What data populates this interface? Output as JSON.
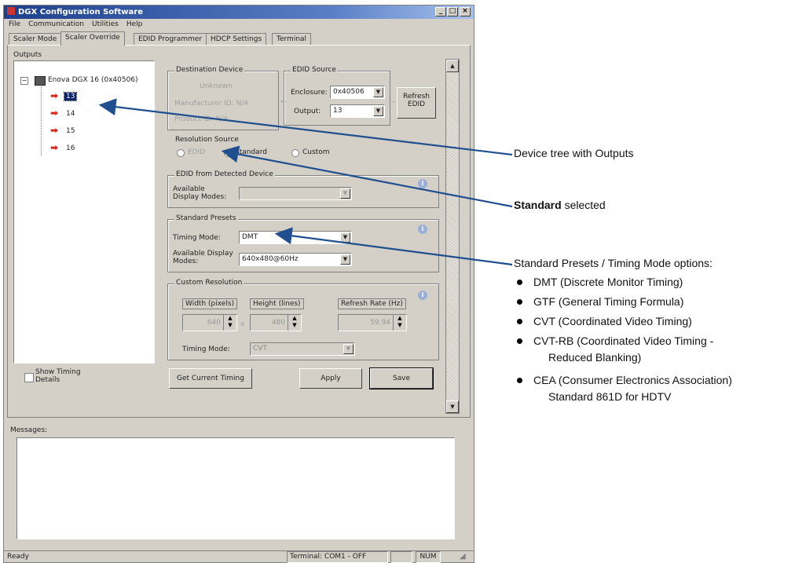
{
  "window": {
    "title": "DGX Configuration Software",
    "menu": [
      "File",
      "Communication",
      "Utilities",
      "Help"
    ],
    "tabs": [
      "Scaler Mode",
      "Scaler Override",
      "EDID Programmer",
      "HDCP Settings",
      "Terminal"
    ],
    "active_tab": "Scaler Override"
  },
  "outputs": {
    "label": "Outputs",
    "root": "Enova DGX 16 (0x40506)",
    "items": [
      "13",
      "14",
      "15",
      "16"
    ],
    "selected": "13",
    "show_timing_label": "Show Timing Details"
  },
  "destination_device": {
    "label": "Destination Device",
    "line1": "Unknown",
    "line2": "Manufacturer ID: N/A",
    "line3": "Product ID: N/A"
  },
  "edid_source": {
    "label": "EDID Source",
    "enclosure_label": "Enclosure:",
    "enclosure_value": "0x40506",
    "output_label": "Output:",
    "output_value": "13",
    "refresh_label": "Refresh EDID"
  },
  "resolution_source": {
    "label": "Resolution Source",
    "options": [
      "EDID",
      "Standard",
      "Custom"
    ],
    "selected": "Standard"
  },
  "edid_detected": {
    "label": "EDID from Detected Device",
    "modes_label": "Available Display Modes:",
    "modes_value": ""
  },
  "standard_presets": {
    "label": "Standard Presets",
    "timing_label": "Timing Mode:",
    "timing_value": "DMT",
    "modes_label": "Available Display Modes:",
    "modes_value": "640x480@60Hz"
  },
  "custom_resolution": {
    "label": "Custom Resolution",
    "width_label": "Width (pixels)",
    "width_value": "640",
    "height_label": "Height (lines)",
    "height_value": "480",
    "refresh_label": "Refresh Rate (Hz)",
    "refresh_value": "59.94",
    "timing_label": "Timing Mode:",
    "timing_value": "CVT"
  },
  "buttons": {
    "get_timing": "Get Current Timing",
    "apply": "Apply",
    "save": "Save"
  },
  "messages": {
    "label": "Messages:"
  },
  "status": {
    "ready": "Ready",
    "terminal": "Terminal: COM1 - OFF",
    "num": "NUM"
  },
  "annotations": {
    "device_tree": "Device tree with Outputs",
    "standard_bold": "Standard",
    "standard_rest": " selected",
    "presets_title": "Standard Presets / Timing Mode options:",
    "bullets": [
      "DMT (Discrete Monitor Timing)",
      "GTF (General Timing Formula)",
      "CVT (Coordinated Video Timing)",
      "CVT-RB (Coordinated Video Timing -",
      "CEA (Consumer Electronics Association)"
    ],
    "bullet4_cont": "Reduced Blanking)",
    "bullet5_cont": "Standard 861D for HDTV"
  },
  "colors": {
    "title_gradient_start": "#1d3f8c",
    "arrow_blue": "#1f4f8f",
    "tree_arrow_red": "#d9261c"
  }
}
